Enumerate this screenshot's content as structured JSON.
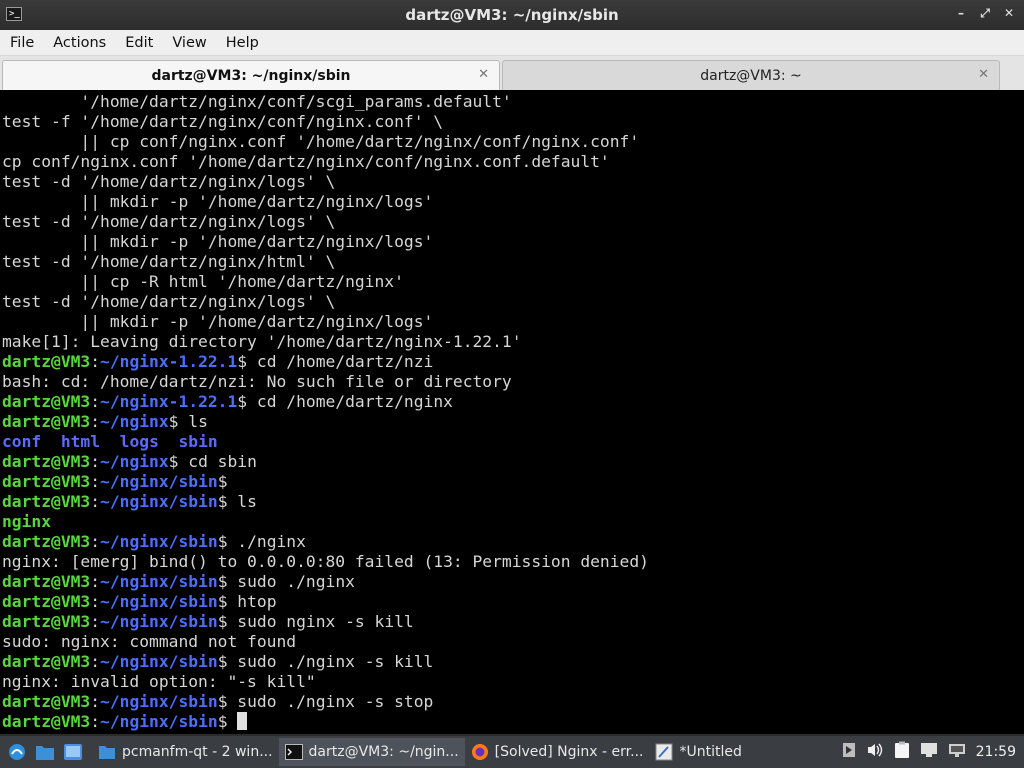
{
  "window": {
    "title": "dartz@VM3: ~/nginx/sbin",
    "controls": [
      "minimize",
      "maximize",
      "close"
    ]
  },
  "menubar": {
    "items": [
      "File",
      "Actions",
      "Edit",
      "View",
      "Help"
    ]
  },
  "tabs": [
    {
      "label": "dartz@VM3: ~/nginx/sbin",
      "active": true
    },
    {
      "label": "dartz@VM3: ~",
      "active": false
    }
  ],
  "terminal": {
    "lines": [
      {
        "parts": [
          {
            "t": "        '/home/dartz/nginx/conf/scgi_params.default'",
            "c": ""
          }
        ]
      },
      {
        "parts": [
          {
            "t": "test -f '/home/dartz/nginx/conf/nginx.conf' \\",
            "c": ""
          }
        ]
      },
      {
        "parts": [
          {
            "t": "        || cp conf/nginx.conf '/home/dartz/nginx/conf/nginx.conf'",
            "c": ""
          }
        ]
      },
      {
        "parts": [
          {
            "t": "cp conf/nginx.conf '/home/dartz/nginx/conf/nginx.conf.default'",
            "c": ""
          }
        ]
      },
      {
        "parts": [
          {
            "t": "test -d '/home/dartz/nginx/logs' \\",
            "c": ""
          }
        ]
      },
      {
        "parts": [
          {
            "t": "        || mkdir -p '/home/dartz/nginx/logs'",
            "c": ""
          }
        ]
      },
      {
        "parts": [
          {
            "t": "test -d '/home/dartz/nginx/logs' \\",
            "c": ""
          }
        ]
      },
      {
        "parts": [
          {
            "t": "        || mkdir -p '/home/dartz/nginx/logs'",
            "c": ""
          }
        ]
      },
      {
        "parts": [
          {
            "t": "test -d '/home/dartz/nginx/html' \\",
            "c": ""
          }
        ]
      },
      {
        "parts": [
          {
            "t": "        || cp -R html '/home/dartz/nginx'",
            "c": ""
          }
        ]
      },
      {
        "parts": [
          {
            "t": "test -d '/home/dartz/nginx/logs' \\",
            "c": ""
          }
        ]
      },
      {
        "parts": [
          {
            "t": "        || mkdir -p '/home/dartz/nginx/logs'",
            "c": ""
          }
        ]
      },
      {
        "parts": [
          {
            "t": "make[1]: Leaving directory '/home/dartz/nginx-1.22.1'",
            "c": ""
          }
        ]
      },
      {
        "parts": [
          {
            "t": "dartz@VM3",
            "c": "pu"
          },
          {
            "t": ":",
            "c": ""
          },
          {
            "t": "~/nginx-1.22.1",
            "c": "pp"
          },
          {
            "t": "$ cd /home/dartz/nzi",
            "c": ""
          }
        ]
      },
      {
        "parts": [
          {
            "t": "bash: cd: /home/dartz/nzi: No such file or directory",
            "c": ""
          }
        ]
      },
      {
        "parts": [
          {
            "t": "dartz@VM3",
            "c": "pu"
          },
          {
            "t": ":",
            "c": ""
          },
          {
            "t": "~/nginx-1.22.1",
            "c": "pp"
          },
          {
            "t": "$ cd /home/dartz/nginx",
            "c": ""
          }
        ]
      },
      {
        "parts": [
          {
            "t": "dartz@VM3",
            "c": "pu"
          },
          {
            "t": ":",
            "c": ""
          },
          {
            "t": "~/nginx",
            "c": "pp"
          },
          {
            "t": "$ ls",
            "c": ""
          }
        ]
      },
      {
        "parts": [
          {
            "t": "conf",
            "c": "dir"
          },
          {
            "t": "  ",
            "c": ""
          },
          {
            "t": "html",
            "c": "dir"
          },
          {
            "t": "  ",
            "c": ""
          },
          {
            "t": "logs",
            "c": "dir"
          },
          {
            "t": "  ",
            "c": ""
          },
          {
            "t": "sbin",
            "c": "dir"
          }
        ]
      },
      {
        "parts": [
          {
            "t": "dartz@VM3",
            "c": "pu"
          },
          {
            "t": ":",
            "c": ""
          },
          {
            "t": "~/nginx",
            "c": "pp"
          },
          {
            "t": "$ cd sbin",
            "c": ""
          }
        ]
      },
      {
        "parts": [
          {
            "t": "dartz@VM3",
            "c": "pu"
          },
          {
            "t": ":",
            "c": ""
          },
          {
            "t": "~/nginx/sbin",
            "c": "pp"
          },
          {
            "t": "$",
            "c": ""
          }
        ]
      },
      {
        "parts": [
          {
            "t": "dartz@VM3",
            "c": "pu"
          },
          {
            "t": ":",
            "c": ""
          },
          {
            "t": "~/nginx/sbin",
            "c": "pp"
          },
          {
            "t": "$ ls",
            "c": ""
          }
        ]
      },
      {
        "parts": [
          {
            "t": "nginx",
            "c": "exe"
          }
        ]
      },
      {
        "parts": [
          {
            "t": "dartz@VM3",
            "c": "pu"
          },
          {
            "t": ":",
            "c": ""
          },
          {
            "t": "~/nginx/sbin",
            "c": "pp"
          },
          {
            "t": "$ ./nginx",
            "c": ""
          }
        ]
      },
      {
        "parts": [
          {
            "t": "nginx: [emerg] bind() to 0.0.0.0:80 failed (13: Permission denied)",
            "c": ""
          }
        ]
      },
      {
        "parts": [
          {
            "t": "dartz@VM3",
            "c": "pu"
          },
          {
            "t": ":",
            "c": ""
          },
          {
            "t": "~/nginx/sbin",
            "c": "pp"
          },
          {
            "t": "$ sudo ./nginx",
            "c": ""
          }
        ]
      },
      {
        "parts": [
          {
            "t": "dartz@VM3",
            "c": "pu"
          },
          {
            "t": ":",
            "c": ""
          },
          {
            "t": "~/nginx/sbin",
            "c": "pp"
          },
          {
            "t": "$ htop",
            "c": ""
          }
        ]
      },
      {
        "parts": [
          {
            "t": "dartz@VM3",
            "c": "pu"
          },
          {
            "t": ":",
            "c": ""
          },
          {
            "t": "~/nginx/sbin",
            "c": "pp"
          },
          {
            "t": "$ sudo nginx -s kill",
            "c": ""
          }
        ]
      },
      {
        "parts": [
          {
            "t": "sudo: nginx: command not found",
            "c": ""
          }
        ]
      },
      {
        "parts": [
          {
            "t": "dartz@VM3",
            "c": "pu"
          },
          {
            "t": ":",
            "c": ""
          },
          {
            "t": "~/nginx/sbin",
            "c": "pp"
          },
          {
            "t": "$ sudo ./nginx -s kill",
            "c": ""
          }
        ]
      },
      {
        "parts": [
          {
            "t": "nginx: invalid option: \"-s kill\"",
            "c": ""
          }
        ]
      },
      {
        "parts": [
          {
            "t": "dartz@VM3",
            "c": "pu"
          },
          {
            "t": ":",
            "c": ""
          },
          {
            "t": "~/nginx/sbin",
            "c": "pp"
          },
          {
            "t": "$ sudo ./nginx -s stop",
            "c": ""
          }
        ]
      },
      {
        "parts": [
          {
            "t": "dartz@VM3",
            "c": "pu"
          },
          {
            "t": ":",
            "c": ""
          },
          {
            "t": "~/nginx/sbin",
            "c": "pp"
          },
          {
            "t": "$ ",
            "c": ""
          }
        ],
        "cursor": true
      }
    ]
  },
  "taskbar": {
    "launchers": [
      {
        "icon": "start-menu-icon",
        "color": "#2f8fdc"
      },
      {
        "icon": "folder-icon",
        "color": "#3d8fd8"
      },
      {
        "icon": "show-desktop-icon",
        "color": "#4a8fe0"
      }
    ],
    "tasks": [
      {
        "label": "pcmanfm-qt - 2 win...",
        "icon": "file-manager-icon",
        "active": false
      },
      {
        "label": "dartz@VM3: ~/ngin...",
        "icon": "terminal-icon",
        "active": true
      },
      {
        "label": "[Solved] Nginx - err...",
        "icon": "firefox-icon",
        "active": false
      },
      {
        "label": "*Untitled",
        "icon": "text-editor-icon",
        "active": false
      }
    ],
    "tray": {
      "icons": [
        "media-icon",
        "volume-icon",
        "clipboard-icon",
        "display-icon",
        "network-icon"
      ],
      "clock": "21:59"
    }
  }
}
